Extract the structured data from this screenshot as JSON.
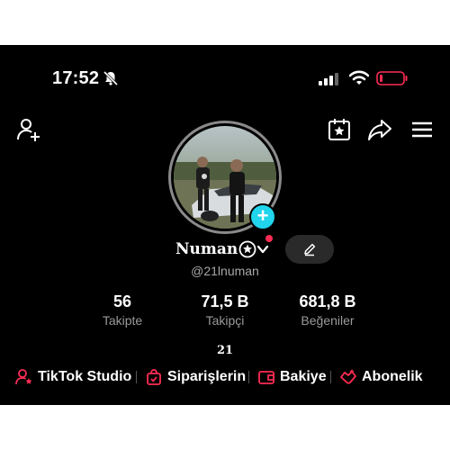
{
  "status_bar": {
    "time": "17:52"
  },
  "profile": {
    "name": "Numan",
    "handle": "@21lnuman",
    "bio": "21"
  },
  "stats": [
    {
      "value": "56",
      "label": "Takipte"
    },
    {
      "value": "71,5 B",
      "label": "Takipçi"
    },
    {
      "value": "681,8 B",
      "label": "Beğeniler"
    }
  ],
  "quick_links": [
    {
      "label": "TikTok Studio",
      "icon": "person-star-icon"
    },
    {
      "label": "Siparişlerin",
      "icon": "shopping-bag-icon"
    },
    {
      "label": "Bakiye",
      "icon": "wallet-icon"
    },
    {
      "label": "Abonelik",
      "icon": "handshake-star-icon"
    }
  ],
  "colors": {
    "background": "#000000",
    "accent_red": "#fe2c55",
    "accent_cyan": "#20d5ec",
    "secondary_text": "#9a9a9a"
  }
}
